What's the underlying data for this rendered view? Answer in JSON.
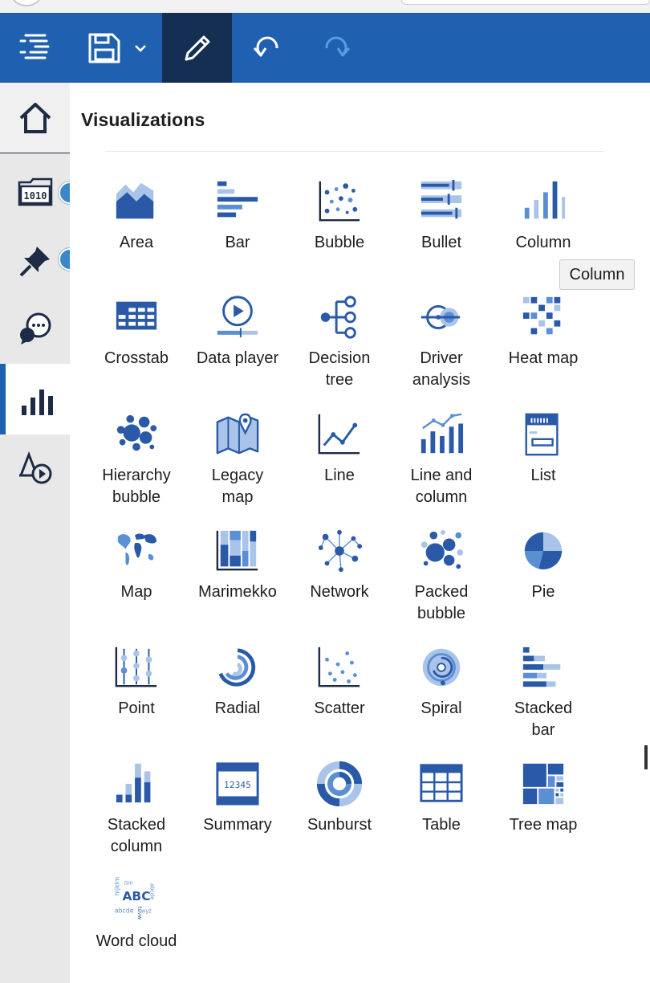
{
  "toolbar": {
    "menu_icon": "menu-icon",
    "save_icon": "save-icon",
    "edit_icon": "pencil-icon",
    "undo_icon": "undo-icon",
    "redo_icon": "redo-icon",
    "bg": "#1f61b0",
    "active_bg": "#152f52"
  },
  "rail": {
    "items": [
      "home",
      "data-sources",
      "pins",
      "comments",
      "visualizations",
      "animations"
    ]
  },
  "panel": {
    "title": "Visualizations",
    "tooltip": "Column",
    "items": [
      {
        "label": "Area",
        "icon": "area-icon"
      },
      {
        "label": "Bar",
        "icon": "bar-icon"
      },
      {
        "label": "Bubble",
        "icon": "bubble-icon"
      },
      {
        "label": "Bullet",
        "icon": "bullet-icon"
      },
      {
        "label": "Column",
        "icon": "column-icon"
      },
      {
        "label": "Crosstab",
        "icon": "crosstab-icon"
      },
      {
        "label": "Data player",
        "icon": "data-player-icon"
      },
      {
        "label": "Decision\ntree",
        "icon": "decision-tree-icon"
      },
      {
        "label": "Driver\nanalysis",
        "icon": "driver-analysis-icon"
      },
      {
        "label": "Heat map",
        "icon": "heat-map-icon"
      },
      {
        "label": "Hierarchy\nbubble",
        "icon": "hierarchy-bubble-icon"
      },
      {
        "label": "Legacy\nmap",
        "icon": "legacy-map-icon"
      },
      {
        "label": "Line",
        "icon": "line-icon"
      },
      {
        "label": "Line and\ncolumn",
        "icon": "line-and-column-icon"
      },
      {
        "label": "List",
        "icon": "list-icon"
      },
      {
        "label": "Map",
        "icon": "map-icon"
      },
      {
        "label": "Marimekko",
        "icon": "marimekko-icon"
      },
      {
        "label": "Network",
        "icon": "network-icon"
      },
      {
        "label": "Packed\nbubble",
        "icon": "packed-bubble-icon"
      },
      {
        "label": "Pie",
        "icon": "pie-icon"
      },
      {
        "label": "Point",
        "icon": "point-icon"
      },
      {
        "label": "Radial",
        "icon": "radial-icon"
      },
      {
        "label": "Scatter",
        "icon": "scatter-icon"
      },
      {
        "label": "Spiral",
        "icon": "spiral-icon"
      },
      {
        "label": "Stacked\nbar",
        "icon": "stacked-bar-icon"
      },
      {
        "label": "Stacked\ncolumn",
        "icon": "stacked-column-icon"
      },
      {
        "label": "Summary",
        "icon": "summary-icon",
        "icon_text": "12345"
      },
      {
        "label": "Sunburst",
        "icon": "sunburst-icon"
      },
      {
        "label": "Table",
        "icon": "table-icon"
      },
      {
        "label": "Tree map",
        "icon": "tree-map-icon"
      },
      {
        "label": "Word cloud",
        "icon": "word-cloud-icon",
        "icon_text": "ABC"
      }
    ]
  },
  "colors": {
    "dark": "#2a5aa7",
    "mid": "#5b8fd4",
    "light": "#a9c4e8",
    "navy": "#1d2b44",
    "badge": "#3a88c9"
  }
}
